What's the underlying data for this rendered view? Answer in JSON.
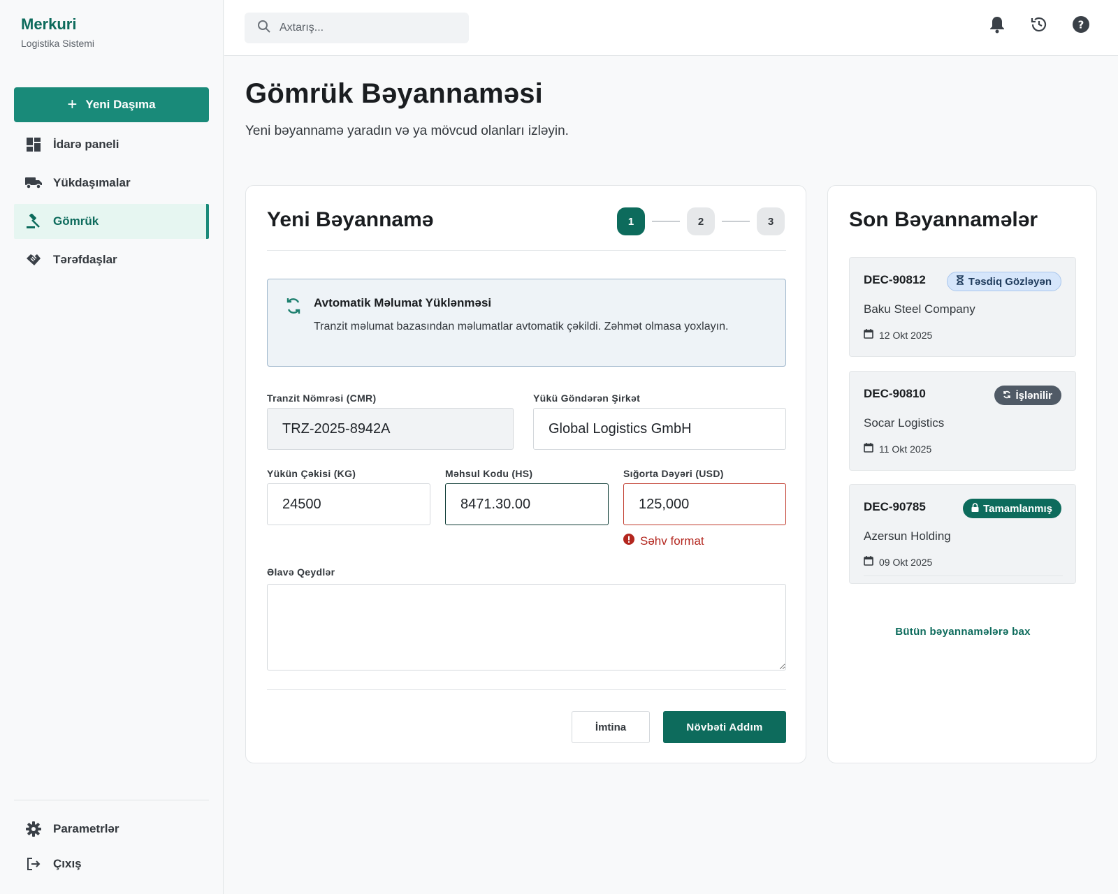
{
  "brand": {
    "name": "Merkuri",
    "subtitle": "Logistika Sistemi"
  },
  "sidebar": {
    "new_button": "Yeni Daşıma",
    "items": [
      {
        "label": "İdarə paneli",
        "icon": "dashboard-icon",
        "active": false
      },
      {
        "label": "Yükdaşımalar",
        "icon": "truck-icon",
        "active": false
      },
      {
        "label": "Gömrük",
        "icon": "gavel-icon",
        "active": true
      },
      {
        "label": "Tərəfdaşlar",
        "icon": "handshake-icon",
        "active": false
      }
    ],
    "bottom": [
      {
        "label": "Parametrlər",
        "icon": "gear-icon"
      },
      {
        "label": "Çıxış",
        "icon": "logout-icon"
      }
    ]
  },
  "topbar": {
    "search_placeholder": "Axtarış...",
    "icons": [
      "bell-icon",
      "history-icon",
      "help-icon"
    ]
  },
  "page": {
    "title": "Gömrük Bəyannaməsi",
    "subtitle": "Yeni bəyannamə yaradın və ya mövcud olanları izləyin."
  },
  "form": {
    "title": "Yeni Bəyannamə",
    "steps": [
      "1",
      "2",
      "3"
    ],
    "current_step": 1,
    "info": {
      "title": "Avtomatik Məlumat Yüklənməsi",
      "text": "Tranzit məlumat bazasından məlumatlar avtomatik çəkildi. Zəhmət olmasa yoxlayın."
    },
    "fields": {
      "cmr": {
        "label": "Tranzit Nömrəsi (CMR)",
        "value": "TRZ-2025-8942A"
      },
      "sender": {
        "label": "Yükü Göndərən Şirkət",
        "value": "Global Logistics GmbH"
      },
      "weight": {
        "label": "Yükün Çəkisi (KG)",
        "value": "24500"
      },
      "hs_code": {
        "label": "Məhsul Kodu (HS)",
        "value": "8471.30.00"
      },
      "insurance": {
        "label": "Sığorta Dəyəri (USD)",
        "value": "125,000",
        "error": "Səhv format"
      },
      "notes": {
        "label": "Əlavə Qeydlər",
        "value": ""
      }
    },
    "cancel_label": "İmtina",
    "next_label": "Növbəti Addım"
  },
  "recent": {
    "title": "Son Bəyannamələr",
    "items": [
      {
        "id": "DEC-90812",
        "status": "Təsdiq Gözləyən",
        "company": "Baku Steel Company",
        "date": "12 Okt 2025"
      },
      {
        "id": "DEC-90810",
        "status": "İşlənilir",
        "company": "Socar Logistics",
        "date": "11 Okt 2025"
      },
      {
        "id": "DEC-90785",
        "status": "Tamamlanmış",
        "company": "Azersun Holding",
        "date": "09 Okt 2025"
      }
    ],
    "view_all": "Bütün bəyannamələrə bax"
  },
  "colors": {
    "primary": "#0d6b5c",
    "accent": "#198a79",
    "error": "#b3261e",
    "pending": "#d6e6fb",
    "processing": "#505a66"
  }
}
